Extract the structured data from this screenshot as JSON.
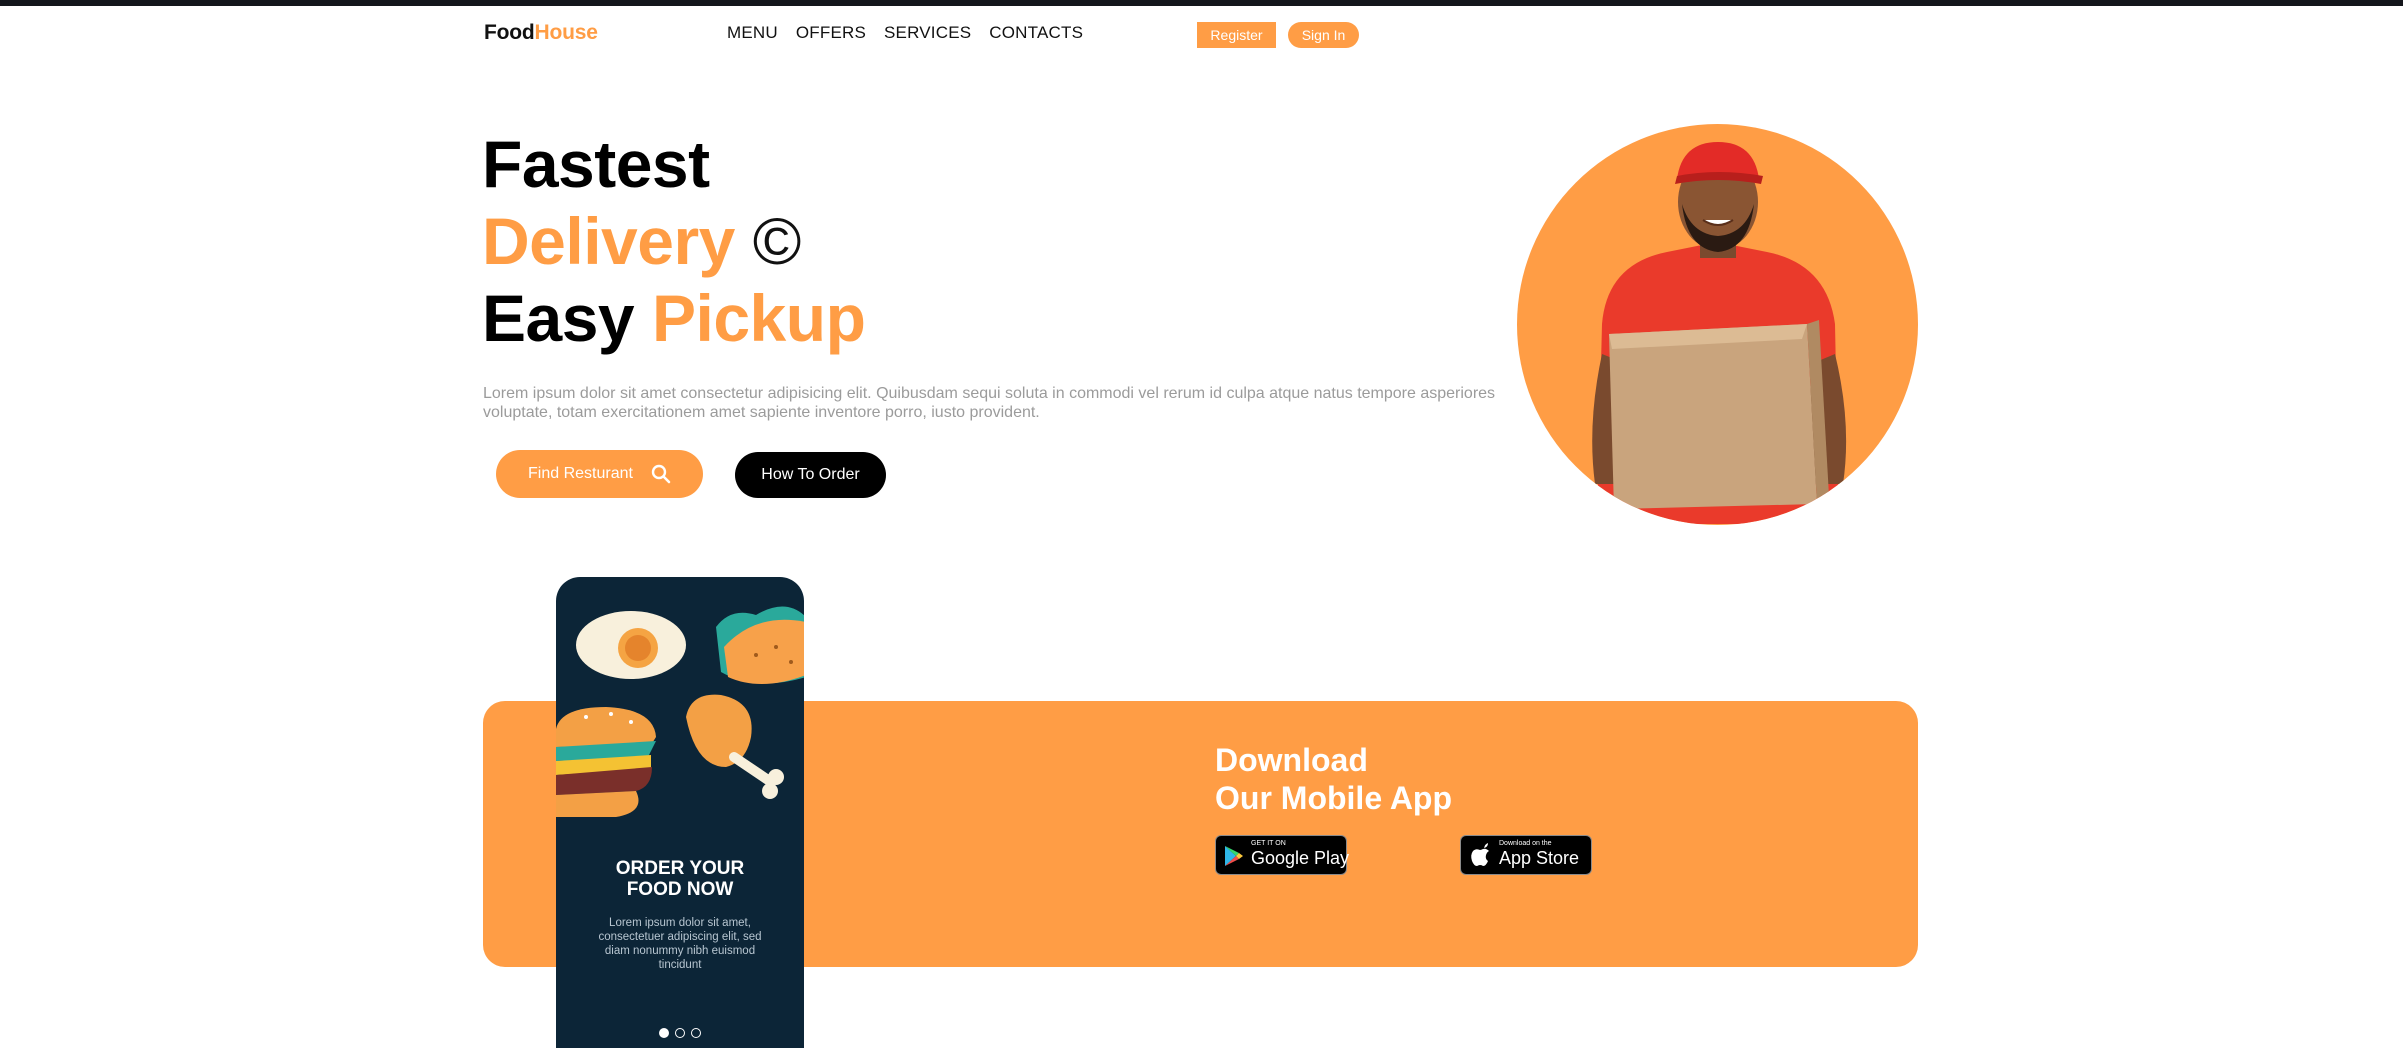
{
  "nav": {
    "logo_part1": "Food",
    "logo_part2": "House",
    "links": [
      "MENU",
      "OFFERS",
      "SERVICES",
      "CONTACTS"
    ],
    "register_label": "Register",
    "signin_label": "Sign In"
  },
  "hero": {
    "line1": "Fastest",
    "line2_accent": "Delivery",
    "line2_symbol": "©",
    "line3_plain": "Easy",
    "line3_accent": "Pickup",
    "description": "Lorem ipsum dolor sit amet consectetur adipisicing elit. Quibusdam sequi soluta in commodi vel rerum id culpa atque natus tempore asperiores voluptate, totam exercitationem amet sapiente inventore porro, iusto provident.",
    "find_label": "Find Resturant",
    "how_label": "How To Order"
  },
  "app": {
    "title_line1": "Download",
    "title_line2": "Our Mobile App",
    "google_small": "GET IT ON",
    "google_big": "Google Play",
    "apple_small": "Download on the",
    "apple_big": "App Store"
  },
  "phone": {
    "title_line1": "ORDER YOUR",
    "title_line2": "FOOD NOW",
    "text": "Lorem ipsum dolor sit amet, consectetuer adipiscing elit, sed  diam nonummy nibh euismod tincidunt",
    "active_dot": 0,
    "dot_count": 3
  },
  "colors": {
    "accent": "#ff9d45",
    "phone_bg": "#0c2537",
    "text_muted": "#9b9b9b"
  }
}
